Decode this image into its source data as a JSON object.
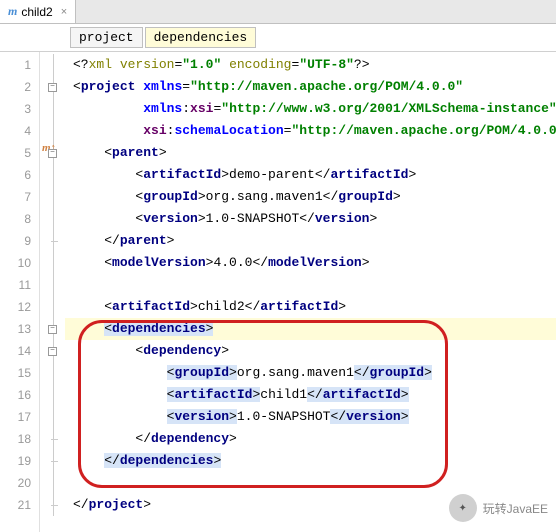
{
  "tab": {
    "icon": "m",
    "label": "child2"
  },
  "breadcrumb": {
    "root": "project",
    "current": "dependencies"
  },
  "watermark": "玩转JavaEE",
  "lines": [
    {
      "n": 1,
      "pre": "",
      "html": "&lt;?<span class='t-xml'>xml version</span>=<span class='t-val'>\"1.0\"</span> <span class='t-xml'>encoding</span>=<span class='t-val'>\"UTF-8\"</span>?&gt;"
    },
    {
      "n": 2,
      "pre": "",
      "html": "&lt;<span class='t-tag'>project</span> <span class='t-attr'>xmlns</span>=<span class='t-val'>\"http://maven.apache.org/POM/4.0.0\"</span>"
    },
    {
      "n": 3,
      "pre": "         ",
      "html": "<span class='t-attr'>xmlns</span>:<span class='t-ns'>xsi</span>=<span class='t-val'>\"http://www.w3.org/2001/XMLSchema-instance\"</span>"
    },
    {
      "n": 4,
      "pre": "         ",
      "html": "<span class='t-ns'>xsi</span>:<span class='t-attr'>schemaLocation</span>=<span class='t-val'>\"http://maven.apache.org/POM/4.0.0</span>"
    },
    {
      "n": 5,
      "pre": "    ",
      "html": "&lt;<span class='t-tag'>parent</span>&gt;"
    },
    {
      "n": 6,
      "pre": "        ",
      "html": "&lt;<span class='t-tag'>artifactId</span>&gt;demo-parent&lt;/<span class='t-tag'>artifactId</span>&gt;"
    },
    {
      "n": 7,
      "pre": "        ",
      "html": "&lt;<span class='t-tag'>groupId</span>&gt;org.sang.maven1&lt;/<span class='t-tag'>groupId</span>&gt;"
    },
    {
      "n": 8,
      "pre": "        ",
      "html": "&lt;<span class='t-tag'>version</span>&gt;1.0-SNAPSHOT&lt;/<span class='t-tag'>version</span>&gt;"
    },
    {
      "n": 9,
      "pre": "    ",
      "html": "&lt;/<span class='t-tag'>parent</span>&gt;"
    },
    {
      "n": 10,
      "pre": "    ",
      "html": "&lt;<span class='t-tag'>modelVersion</span>&gt;4.0.0&lt;/<span class='t-tag'>modelVersion</span>&gt;"
    },
    {
      "n": 11,
      "pre": "",
      "html": ""
    },
    {
      "n": 12,
      "pre": "    ",
      "html": "&lt;<span class='t-tag'>artifactId</span>&gt;child2&lt;/<span class='t-tag'>artifactId</span>&gt;"
    },
    {
      "n": 13,
      "pre": "    ",
      "html": "<span class='hl'>&lt;<span class='t-tag'>dependencies</span>&gt;</span>",
      "hl": true
    },
    {
      "n": 14,
      "pre": "        ",
      "html": "&lt;<span class='t-tag'>dependency</span>&gt;"
    },
    {
      "n": 15,
      "pre": "            ",
      "html": "<span class='hl'>&lt;<span class='t-tag'>groupId</span>&gt;</span>org.sang.maven1<span class='hl'>&lt;/<span class='t-tag'>groupId</span>&gt;</span>"
    },
    {
      "n": 16,
      "pre": "            ",
      "html": "<span class='hl'>&lt;<span class='t-tag'>artifactId</span>&gt;</span>child1<span class='hl'>&lt;/<span class='t-tag'>artifactId</span>&gt;</span>"
    },
    {
      "n": 17,
      "pre": "            ",
      "html": "<span class='hl'>&lt;<span class='t-tag'>version</span>&gt;</span>1.0-SNAPSHOT<span class='hl'>&lt;/<span class='t-tag'>version</span>&gt;</span>"
    },
    {
      "n": 18,
      "pre": "        ",
      "html": "&lt;/<span class='t-tag'>dependency</span>&gt;"
    },
    {
      "n": 19,
      "pre": "    ",
      "html": "<span class='hl'>&lt;/<span class='t-tag'>dependencies</span>&gt;</span>"
    },
    {
      "n": 20,
      "pre": "",
      "html": ""
    },
    {
      "n": 21,
      "pre": "",
      "html": "&lt;/<span class='t-tag'>project</span>&gt;"
    }
  ],
  "fold": {
    "2": "-",
    "5": "-",
    "9": "e",
    "13": "-",
    "14": "-",
    "18": "e",
    "19": "e",
    "21": "e"
  }
}
